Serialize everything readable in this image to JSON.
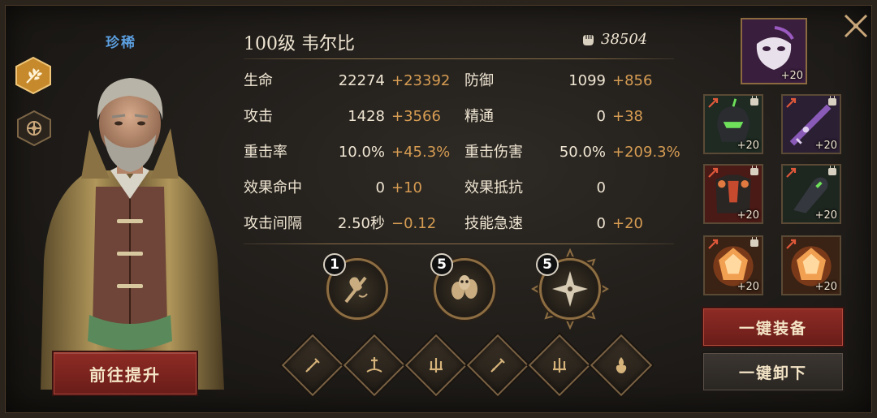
{
  "hero": {
    "rarity": "珍稀",
    "title": "100级 韦尔比",
    "power": "38504"
  },
  "stats": [
    {
      "label": "生命",
      "base": "22274",
      "bonus": "+23392",
      "label2": "防御",
      "base2": "1099",
      "bonus2": "+856"
    },
    {
      "label": "攻击",
      "base": "1428",
      "bonus": "+3566",
      "label2": "精通",
      "base2": "0",
      "bonus2": "+38"
    },
    {
      "label": "重击率",
      "base": "10.0%",
      "bonus": "+45.3%",
      "label2": "重击伤害",
      "base2": "50.0%",
      "bonus2": "+209.3%"
    },
    {
      "label": "效果命中",
      "base": "0",
      "bonus": "+10",
      "label2": "效果抵抗",
      "base2": "0",
      "bonus2": ""
    },
    {
      "label": "攻击间隔",
      "base": "2.50秒",
      "bonus": "−0.12",
      "label2": "技能急速",
      "base2": "0",
      "bonus2": "+20"
    }
  ],
  "skills": [
    {
      "level": "1",
      "icon": "fist-skill-icon"
    },
    {
      "level": "5",
      "icon": "skulls-skill-icon"
    },
    {
      "level": "5",
      "icon": "star-skill-icon"
    }
  ],
  "runes": [
    "sword-rune-icon",
    "altar-sword-rune-icon",
    "trident-rune-icon",
    "sword-rune-icon",
    "trident-rune-icon",
    "flame-rune-icon"
  ],
  "equipment": {
    "top_item": {
      "plus": "+20",
      "icon": "mask-icon"
    },
    "slots": [
      {
        "plus": "+20",
        "icon": "helmet-icon",
        "locked": true
      },
      {
        "plus": "+20",
        "icon": "blade-icon",
        "locked": true
      },
      {
        "plus": "+20",
        "icon": "armor-icon",
        "locked": true
      },
      {
        "plus": "+20",
        "icon": "gauntlet-icon",
        "locked": true
      },
      {
        "plus": "+20",
        "icon": "gem-icon",
        "locked": true
      },
      {
        "plus": "+20",
        "icon": "gem-icon",
        "locked": false
      }
    ]
  },
  "buttons": {
    "upgrade": "前往提升",
    "equip_all": "一键装备",
    "unequip_all": "一键卸下"
  },
  "colors": {
    "rarity": "#5c9fe0",
    "bonus": "#d69c52",
    "primary_button": "#8e2b25",
    "secondary_button": "#3b3631"
  }
}
